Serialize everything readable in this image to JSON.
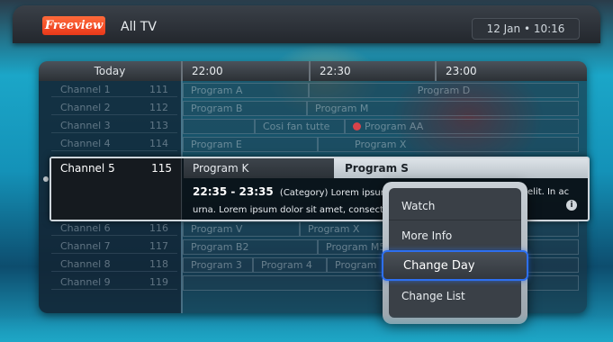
{
  "header": {
    "logo_text": "Freeview",
    "list_name": "All TV",
    "clock": "12 Jan • 10:16"
  },
  "guide": {
    "day": "Today",
    "times": [
      "22:00",
      "22:30",
      "23:00"
    ],
    "channels_top": [
      {
        "name": "Channel 1",
        "number": "111"
      },
      {
        "name": "Channel 2",
        "number": "112"
      },
      {
        "name": "Channel 3",
        "number": "113"
      },
      {
        "name": "Channel 4",
        "number": "114"
      }
    ],
    "channels_bottom": [
      {
        "name": "Channel 6",
        "number": "116"
      },
      {
        "name": "Channel 7",
        "number": "117"
      },
      {
        "name": "Channel 8",
        "number": "118"
      },
      {
        "name": "Channel 9",
        "number": "119"
      }
    ],
    "programs": {
      "r1": [
        "Program A",
        "Program D"
      ],
      "r2": [
        "Program B",
        "Program M"
      ],
      "r3": [
        "Cosi fan tutte",
        "Program AA"
      ],
      "r4": [
        "Program E",
        "Program X"
      ],
      "r6": [
        "Program V",
        "Program X"
      ],
      "r7": [
        "Program B2",
        "Program M5"
      ],
      "r8": [
        "Program 3",
        "Program 4",
        "Program"
      ]
    },
    "selected": {
      "channel_name": "Channel 5",
      "channel_number": "115",
      "current_program": "Program K",
      "next_program": "Program S",
      "time_range": "22:35 - 23:35",
      "desc_line1": "(Category) Lorem ipsum dolo",
      "desc_line1_tail": "elit. In ac",
      "desc_line2": "urna. Lorem ipsum dolor sit amet, consectetur",
      "info_glyph": "i"
    }
  },
  "menu": {
    "items": [
      "Watch",
      "More Info",
      "Change Day",
      "Change List"
    ],
    "active_index": 2,
    "accent_color": "#2d6ff0"
  }
}
